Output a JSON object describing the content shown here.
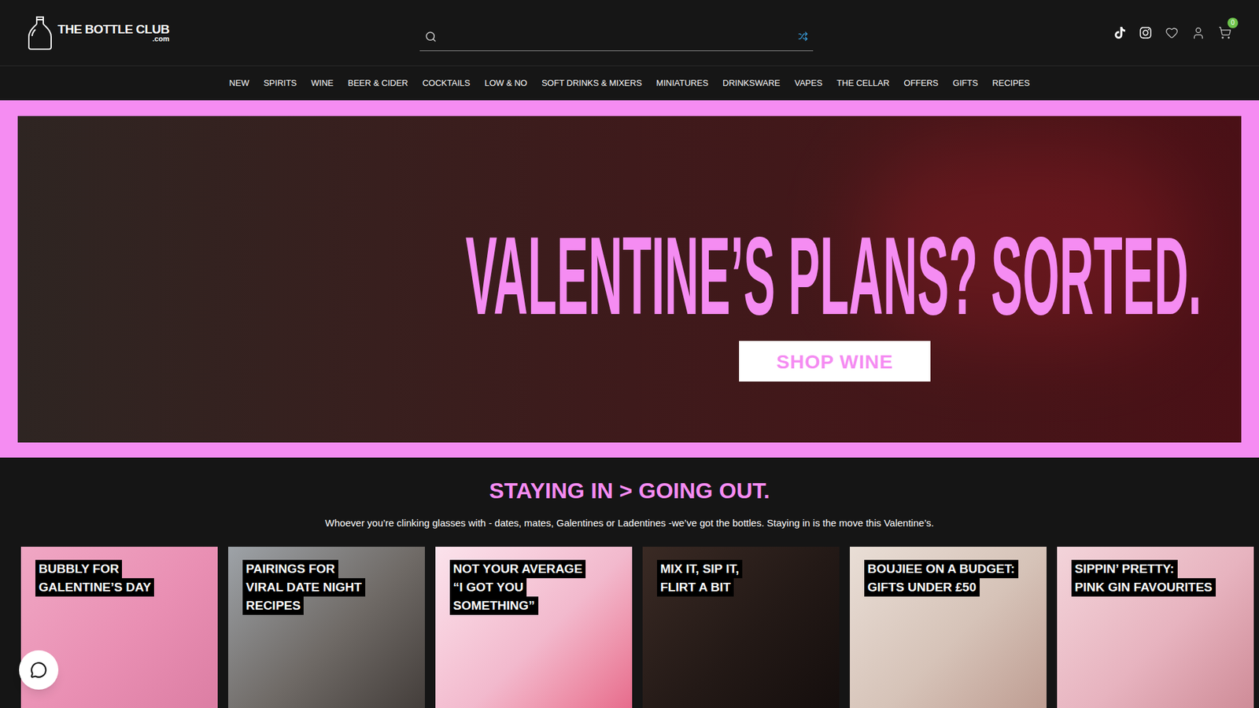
{
  "logo": {
    "name": "THE BOTTLE CLUB",
    "suffix": ".com"
  },
  "cart": {
    "count": "0"
  },
  "nav": [
    "NEW",
    "SPIRITS",
    "WINE",
    "BEER & CIDER",
    "COCKTAILS",
    "LOW & NO",
    "SOFT DRINKS & MIXERS",
    "MINIATURES",
    "DRINKSWARE",
    "VAPES",
    "THE CELLAR",
    "OFFERS",
    "GIFTS",
    "RECIPES"
  ],
  "hero": {
    "headline": "VALENTINE’S PLANS? SORTED.",
    "button": "SHOP WINE"
  },
  "section": {
    "title": "STAYING IN > GOING OUT.",
    "subtitle": "Whoever you’re clinking glasses with - dates, mates, Galentines or Ladentines -we’ve got the bottles. Staying in is the move this Valentine’s."
  },
  "cards": [
    {
      "lines": [
        "BUBBLY FOR",
        "GALENTINE’S DAY"
      ]
    },
    {
      "lines": [
        "PAIRINGS FOR",
        "VIRAL DATE NIGHT",
        "RECIPES"
      ]
    },
    {
      "lines": [
        "NOT YOUR AVERAGE",
        "“I GOT YOU",
        "SOMETHING”"
      ]
    },
    {
      "lines": [
        "MIX IT, SIP IT,",
        "FLIRT A BIT"
      ]
    },
    {
      "lines": [
        "BOUJIEE ON A BUDGET:",
        "GIFTS UNDER £50"
      ]
    },
    {
      "lines": [
        "SIPPIN’ PRETTY:",
        "PINK GIN FAVOURITES"
      ]
    }
  ]
}
